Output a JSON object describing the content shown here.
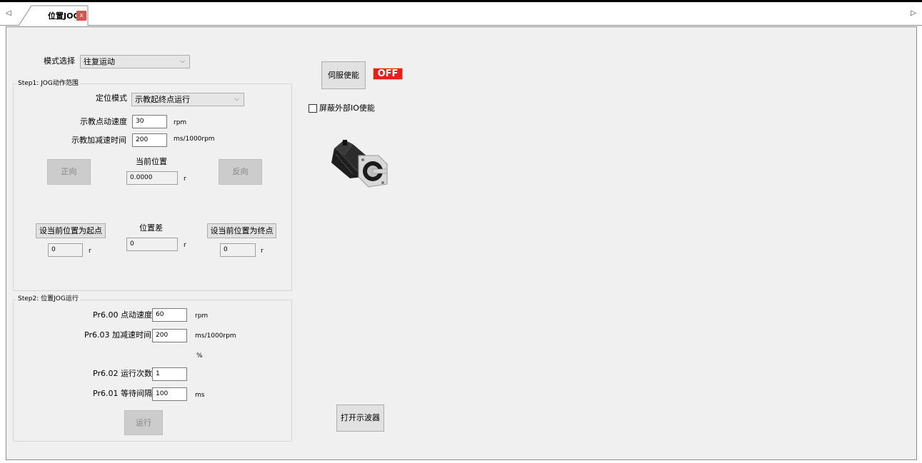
{
  "tab": {
    "title": "位置JOG",
    "close": "x",
    "left_arrow": "◁",
    "right_arrow": "▷"
  },
  "mode": {
    "label": "模式选择",
    "value": "往复运动"
  },
  "step1": {
    "title": "Step1: JOG动作范围",
    "positioning_mode_label": "定位模式",
    "positioning_mode_value": "示教起终点运行",
    "teach_speed_label": "示教点动速度",
    "teach_speed_value": "30",
    "teach_speed_unit": "rpm",
    "teach_accel_label": "示教加减速时间",
    "teach_accel_value": "200",
    "teach_accel_unit": "ms/1000rpm",
    "forward_button": "正向",
    "reverse_button": "反向",
    "current_position_label": "当前位置",
    "current_position_value": "0.0000",
    "current_position_unit": "r",
    "set_start_button": "设当前位置为起点",
    "start_value": "0",
    "start_unit": "r",
    "position_diff_label": "位置差",
    "position_diff_value": "0",
    "position_diff_unit": "r",
    "set_end_button": "设当前位置为终点",
    "end_value": "0",
    "end_unit": "r"
  },
  "step2": {
    "title": "Step2: 位置JOG运行",
    "jog_speed_label": "Pr6.00 点动速度",
    "jog_speed_value": "60",
    "jog_speed_unit": "rpm",
    "accel_label": "Pr6.03 加减速时间",
    "accel_value": "200",
    "accel_unit": "ms/1000rpm",
    "percent_unit": "%",
    "run_count_label": "Pr6.02 运行次数",
    "run_count_value": "1",
    "interval_label": "Pr6.01 等待间隔",
    "interval_value": "100",
    "interval_unit": "ms",
    "run_button": "运行"
  },
  "servo": {
    "enable_button": "伺服使能",
    "status": "OFF",
    "status_color": "#e4201c",
    "mask_io_label": "屏蔽外部IO使能",
    "mask_io_checked": false,
    "motor_image": "servo-motor-image"
  },
  "oscilloscope_button": "打开示波器"
}
